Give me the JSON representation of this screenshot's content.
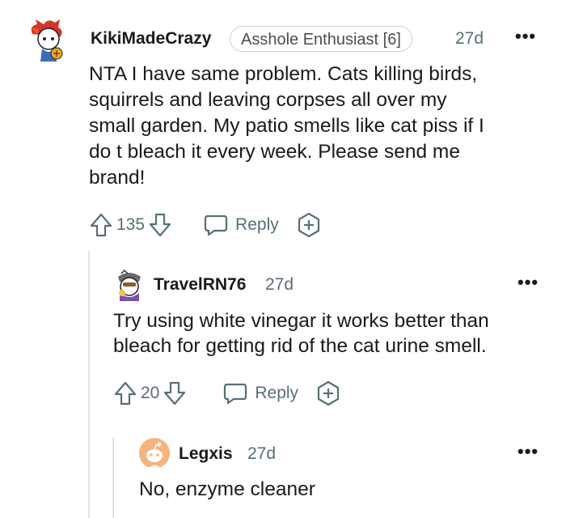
{
  "comments": [
    {
      "username": "KikiMadeCrazy",
      "flair": "Asshole Enthusiast [6]",
      "time": "27d",
      "lines": [
        "NTA I have same problem. Cats killing birds,",
        "squirrels and leaving corpses all over my",
        "small garden. My patio smells like cat piss if I",
        "do t bleach it every week. Please send me",
        "brand!"
      ],
      "votes": "135",
      "reply_label": "Reply"
    },
    {
      "username": "TravelRN76",
      "time": "27d",
      "lines": [
        "Try using white vinegar it works better than",
        "bleach for getting rid of the cat urine smell."
      ],
      "votes": "20",
      "reply_label": "Reply"
    },
    {
      "username": "Legxis",
      "time": "27d",
      "lines": [
        "No, enzyme cleaner"
      ]
    }
  ],
  "more_label": "•••",
  "colors": {
    "text": "#1a1a1b",
    "muted": "#576f76",
    "thread": "#e3e3e3",
    "avatar_legxis": "#f5b47d"
  },
  "icons": [
    "upvote-icon",
    "downvote-icon",
    "reply-icon",
    "award-icon",
    "more-options-icon"
  ]
}
